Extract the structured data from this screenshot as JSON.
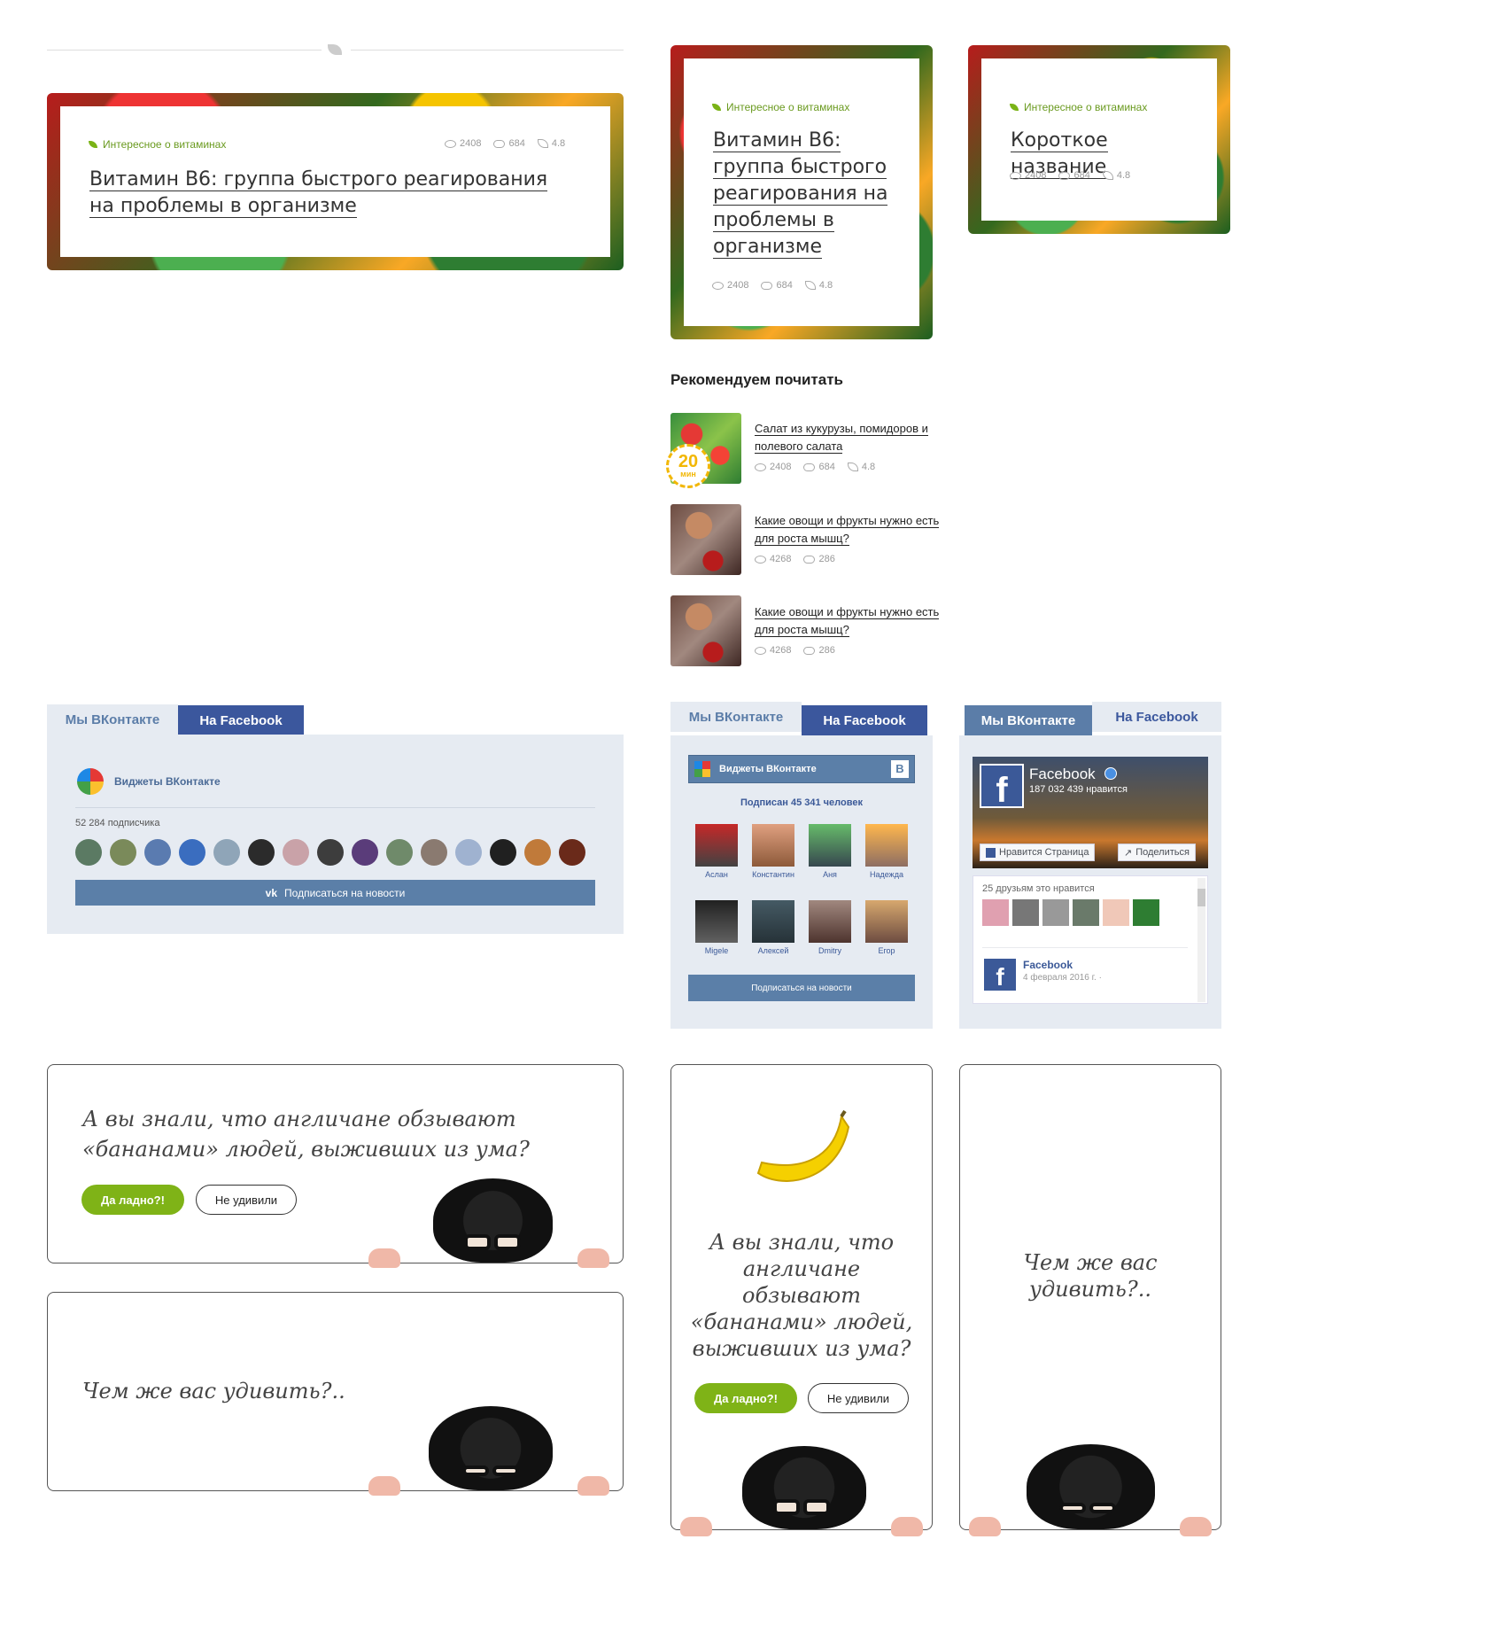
{
  "cards": {
    "category": "Интересное о витаминах",
    "title_long": "Витамин B6: группа быстрого реагирования на проблемы в организме",
    "title_short": "Короткое название",
    "views": "2408",
    "comments": "684",
    "rating": "4.8"
  },
  "recommend": {
    "heading": "Рекомендуем почитать",
    "items": [
      {
        "title": "Салат из кукурузы, помидоров и полевого салата",
        "views": "2408",
        "comments": "684",
        "rating": "4.8",
        "badge_num": "20",
        "badge_unit": "мин"
      },
      {
        "title": "Какие овощи и фрукты нужно есть для роста мышц?",
        "views": "4268",
        "comments": "286"
      },
      {
        "title": "Какие овощи и фрукты нужно есть для роста мышц?",
        "views": "4268",
        "comments": "286"
      }
    ]
  },
  "widgets": {
    "tab_vk": "Мы ВКонтакте",
    "tab_fb": "На Facebook",
    "vk_title": "Виджеты ВКонтакте",
    "vk_subscribers": "52 284 подписчика",
    "vk_subscribe": "Подписаться на новости",
    "vk2_title": "Виджеты ВКонтакте",
    "vk2_subscribed": "Подписан 45 341 человек",
    "vk2_subscribe": "Подписаться на новости",
    "vk2_people": [
      "Аслан",
      "Константин",
      "Аня",
      "Надежда",
      "Migele",
      "Алексей",
      "Dmitry",
      "Егор"
    ],
    "fb_page": "Facebook",
    "fb_likes": "187 032 439 нравится",
    "fb_like_btn": "Нравится Страница",
    "fb_share_btn": "Поделиться",
    "fb_friends": "25 друзьям это нравится",
    "fb_post_name": "Facebook",
    "fb_post_date": "4 февраля 2016 г. ·"
  },
  "banners": {
    "question": "А вы знали, что англичане обзывают «бананами» людей, выживших из ума?",
    "question_lines": [
      "А вы знали, что англичане обзывают",
      "«бананами» людей, выживших из ума?"
    ],
    "question_narrow": [
      "А вы знали, что",
      "англичане",
      "обзывают",
      "«бананами» людей,",
      "выживших из ума?"
    ],
    "btn_yes": "Да ладно?!",
    "btn_no": "Не удивили",
    "surprise": "Чем же вас удивить?..",
    "surprise_narrow": [
      "Чем же вас",
      "удивить?.."
    ]
  },
  "colors": {
    "accent_green": "#7fb317",
    "vk_blue": "#5b7fa8",
    "fb_blue": "#3b579d"
  }
}
